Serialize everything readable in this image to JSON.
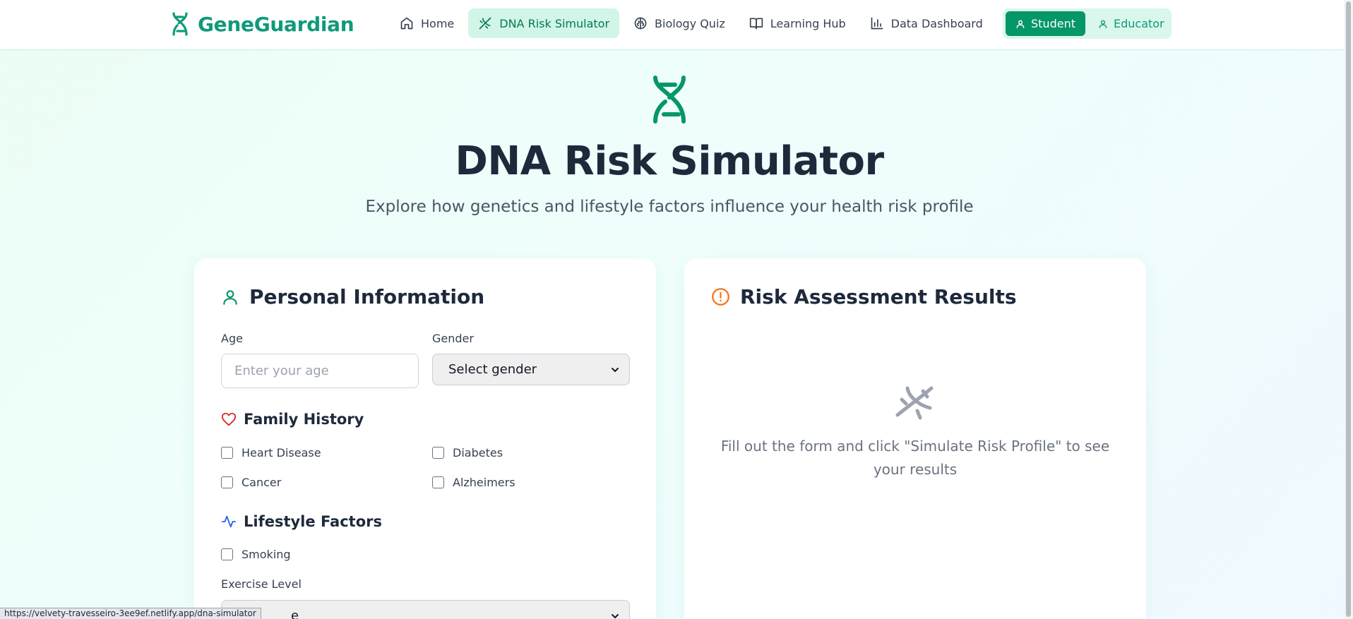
{
  "nav": {
    "brand": "GeneGuardian",
    "links": [
      {
        "label": "Home",
        "icon": "home-icon",
        "active": false
      },
      {
        "label": "DNA Risk Simulator",
        "icon": "dna-icon",
        "active": true
      },
      {
        "label": "Biology Quiz",
        "icon": "brain-icon",
        "active": false
      },
      {
        "label": "Learning Hub",
        "icon": "book-icon",
        "active": false
      },
      {
        "label": "Data Dashboard",
        "icon": "bar-chart-icon",
        "active": false
      }
    ],
    "roles": [
      {
        "label": "Student",
        "active": true
      },
      {
        "label": "Educator",
        "active": false
      }
    ]
  },
  "hero": {
    "title": "DNA Risk Simulator",
    "subtitle": "Explore how genetics and lifestyle factors influence your health risk profile"
  },
  "personal": {
    "title": "Personal Information",
    "age_label": "Age",
    "age_placeholder": "Enter your age",
    "gender_label": "Gender",
    "gender_value": "Select gender",
    "family_history": {
      "title": "Family History",
      "items": [
        "Heart Disease",
        "Diabetes",
        "Cancer",
        "Alzheimers"
      ]
    },
    "lifestyle": {
      "title": "Lifestyle Factors",
      "smoking": "Smoking",
      "exercise_label": "Exercise Level",
      "exercise_value": "e"
    }
  },
  "results": {
    "title": "Risk Assessment Results",
    "empty_text": "Fill out the form and click \"Simulate Risk Profile\" to see your results"
  },
  "status_bar": {
    "url": "https://velvety-travesseiro-3ee9ef.netlify.app/dna-simulator"
  },
  "colors": {
    "brand": "#0f9a7a",
    "accent": "#059669",
    "heart": "#dc2626",
    "activity": "#2563eb",
    "alert": "#f97316"
  }
}
